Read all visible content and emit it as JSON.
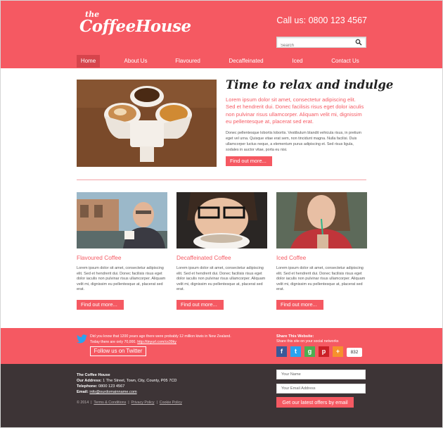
{
  "header": {
    "logo_small": "the",
    "logo_main": "CoffeeHouse",
    "phone": "Call us: 0800 123 4567",
    "search_placeholder": "Search"
  },
  "nav": {
    "items": [
      {
        "label": "Home",
        "active": true
      },
      {
        "label": "About Us"
      },
      {
        "label": "Flavoured"
      },
      {
        "label": "Decaffeinated"
      },
      {
        "label": "Iced"
      },
      {
        "label": "Contact Us"
      }
    ]
  },
  "hero": {
    "title": "Time to relax and indulge",
    "lead": "Lorem ipsum dolor sit amet, consectetur adipiscing elit. Sed et hendrerit dui. Donec facilisis risus eget dolor iaculis non pulvinar risus ullamcorper. Aliquam velit mi, dignissim eu pellentesque at, placerat sed erat.",
    "body": "Donec pellentesque lobortis lobortis. Vestibulum blandit vehicula risus, in pretium eget vel urna. Quisque vitae erat sem, non tincidunt magna. Nulla facilisi. Duis ullamcorper luctus neque, a elementum purus adipiscing et. Sed risus ligula, sodales in auctor vitae, porta eu nisi.",
    "button": "Find out more..."
  },
  "columns": [
    {
      "title": "Flavoured Coffee",
      "body": "Lorem ipsum dolor sit amet, consectetur adipiscing elit. Sed et hendrerit dui. Donec facilisis risus eget dolor iaculis non pulvinar risus ullamcorper. Aliquam velit mi, dignissim eu pellentesque at, placerat sed erat.",
      "button": "Find out more..."
    },
    {
      "title": "Decaffeinated Coffee",
      "body": "Lorem ipsum dolor sit amet, consectetur adipiscing elit. Sed et hendrerit dui. Donec facilisis risus eget dolor iaculis non pulvinar risus ullamcorper. Aliquam velit mi, dignissim eu pellentesque at, placerat sed erat.",
      "button": "Find out more..."
    },
    {
      "title": "Iced Coffee",
      "body": "Lorem ipsum dolor sit amet, consectetur adipiscing elit. Sed et hendrerit dui. Donec facilisis risus eget dolor iaculis non pulvinar risus ullamcorper. Aliquam velit mi, dignissim eu pellentesque at, placerat sed erat.",
      "button": "Find out more..."
    }
  ],
  "twitter": {
    "text": "Did you know that 1200 years ago there were probably 12 million kiwis in New Zealand.",
    "text2": "Today there are only 70,000.",
    "link": "http://tinyurl.com/cs39ky",
    "follow_button": "Follow us on Twitter"
  },
  "share": {
    "title": "Share This Website:",
    "subtitle": "Share this site on your social networks",
    "count": "832",
    "icons": [
      "facebook-icon",
      "twitter-icon",
      "google-plus-icon",
      "pinterest-icon",
      "addthis-icon"
    ]
  },
  "footer": {
    "company": "The Coffee House",
    "address_label": "Our Address:",
    "address": "1 The Street, Town, City, County, P05 7CD",
    "telephone_label": "Telephone:",
    "telephone": "0800 123 4567",
    "email_label": "Email:",
    "email": "info@ourdomainname.com",
    "copyright": "© 2014",
    "links": [
      "Terms & Conditions",
      "Privacy Policy",
      "Cookie Policy"
    ],
    "name_placeholder": "Your Name",
    "email_placeholder": "Your Email Address",
    "offers_button": "Get our latest offers by email"
  },
  "colors": {
    "brand": "#f55962",
    "nav_active": "#d6444c",
    "dark_footer": "#3d3436"
  }
}
